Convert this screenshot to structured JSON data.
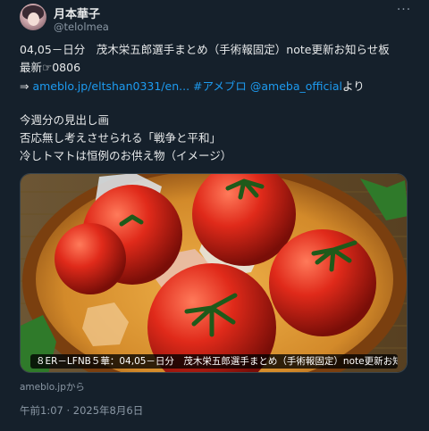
{
  "author": {
    "display_name": "月本華子",
    "handle": "@telolmea"
  },
  "more_label": "···",
  "tweet": {
    "line1": "04,05－日分　茂木栄五郎選手まとめ（手術報固定）note更新お知らせ板",
    "line2": "最新☞0806",
    "arrow": "⇒ ",
    "link_url": "ameblo.jp/eltshan0331/en...",
    "hashtag": "#アメブロ",
    "mention": "@ameba_official",
    "suffix": "より",
    "line4": "今週分の見出し画",
    "line5": "否応無し考えさせられる「戦争と平和」",
    "line6": "冷しトマトは恒例のお供え物（イメージ）"
  },
  "card": {
    "caption": "８ER－LFNB５華：04,05－日分　茂木栄五郎選手まとめ（手術報固定）note更新お知ら...",
    "image_alt": "tomatoes-on-ice-in-wooden-bowl"
  },
  "source": "ameblo.jpから",
  "timestamp": "午前1:07 · 2025年8月6日",
  "colors": {
    "background": "#15202b",
    "text": "#e7e9ea",
    "secondary": "#8b98a5",
    "link": "#1d9bf0"
  }
}
